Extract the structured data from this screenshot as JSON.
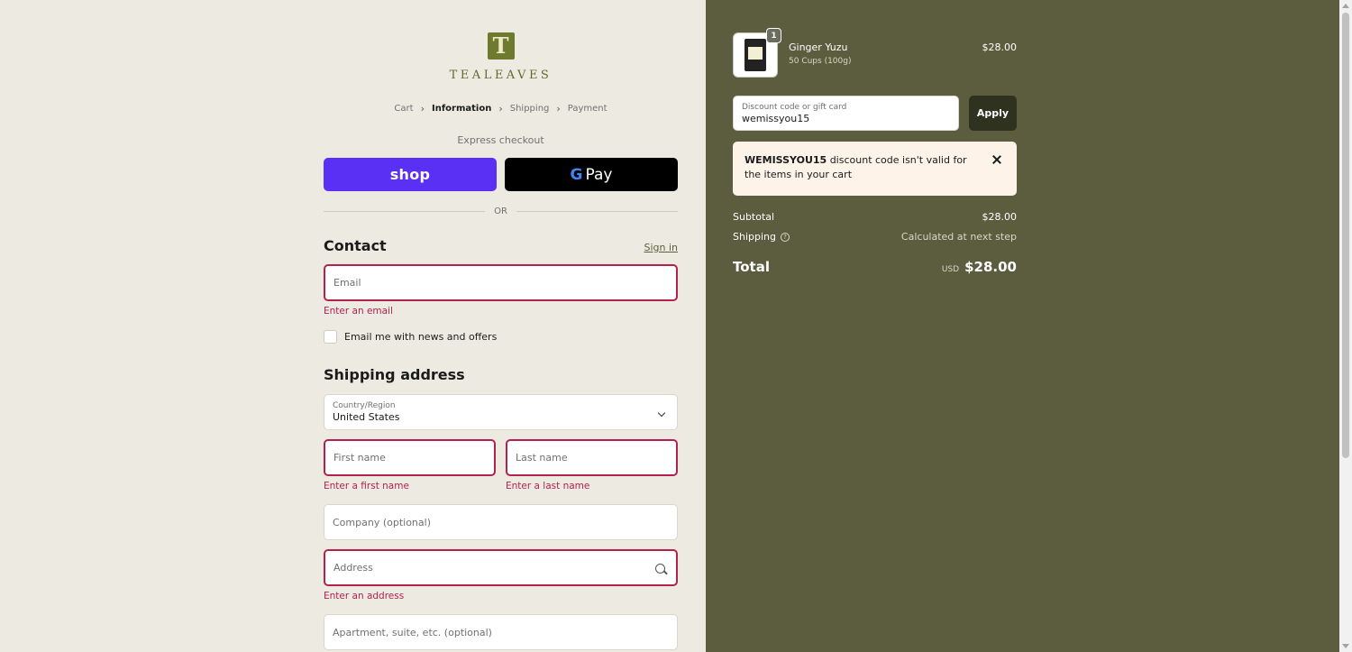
{
  "brand": {
    "logo_letter": "T",
    "name": "TEALEAVES"
  },
  "breadcrumb": {
    "items": [
      "Cart",
      "Information",
      "Shipping",
      "Payment"
    ],
    "current_index": 1
  },
  "express": {
    "label": "Express checkout",
    "shop_label": "shop",
    "gpay_g": "G",
    "gpay_label": "Pay",
    "or_label": "OR"
  },
  "contact": {
    "title": "Contact",
    "signin_label": "Sign in",
    "email_placeholder": "Email",
    "email_error": "Enter an email",
    "news_label": "Email me with news and offers"
  },
  "shipping": {
    "title": "Shipping address",
    "country_label": "Country/Region",
    "country_value": "United States",
    "first_name_placeholder": "First name",
    "first_name_error": "Enter a first name",
    "last_name_placeholder": "Last name",
    "last_name_error": "Enter a last name",
    "company_placeholder": "Company (optional)",
    "address_placeholder": "Address",
    "address_error": "Enter an address",
    "apartment_placeholder": "Apartment, suite, etc. (optional)"
  },
  "order": {
    "product_name": "Ginger Yuzu",
    "product_variant": "50 Cups (100g)",
    "product_price": "$28.00",
    "quantity": "1",
    "discount_label": "Discount code or gift card",
    "discount_value": "wemissyou15",
    "apply_label": "Apply",
    "alert_code": "WEMISSYOU15",
    "alert_text": " discount code isn't valid for the items in your cart",
    "subtotal_label": "Subtotal",
    "subtotal_value": "$28.00",
    "shipping_label": "Shipping",
    "shipping_help": "?",
    "shipping_value": "Calculated at next step",
    "total_label": "Total",
    "currency": "USD",
    "total_value": "$28.00"
  },
  "colors": {
    "left_bg": "#edebe1",
    "right_bg": "#5b5d3e",
    "error": "#b2224d",
    "shop_purple": "#5a31f4",
    "apply_dark": "#2e321e"
  }
}
